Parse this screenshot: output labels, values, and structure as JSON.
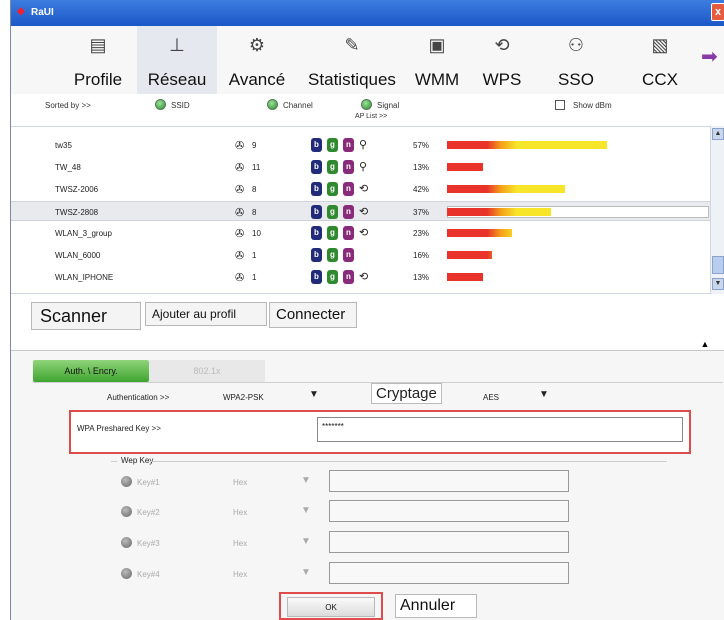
{
  "window": {
    "title": "RaUI",
    "close": "x"
  },
  "toolbar": [
    {
      "label": "Profile",
      "icon": "profile-icon",
      "glyph": "▤"
    },
    {
      "label": "Réseau",
      "icon": "network-icon",
      "glyph": "⊥"
    },
    {
      "label": "Avancé",
      "icon": "advanced-gear-icon",
      "glyph": "⚙"
    },
    {
      "label": "Statistiques",
      "icon": "statistics-icon",
      "glyph": "✎"
    },
    {
      "label": "WMM",
      "icon": "wmm-icon",
      "glyph": "▣"
    },
    {
      "label": "WPS",
      "icon": "wps-icon",
      "glyph": "⟲"
    },
    {
      "label": "SSO",
      "icon": "sso-icon",
      "glyph": "⚇"
    },
    {
      "label": "CCX",
      "icon": "ccx-icon",
      "glyph": "▧"
    }
  ],
  "toolbar_more": "➡",
  "sortbar": {
    "sorted_by": "Sorted by >>",
    "ssid": "SSID",
    "channel": "Channel",
    "signal": "Signal",
    "ap_list": "AP List >>",
    "show_dbm": "Show dBm"
  },
  "ap_list": [
    {
      "ssid": "tw35",
      "channel": "9",
      "modes": [
        "b",
        "g",
        "n"
      ],
      "security": "⚲",
      "signal": "57%",
      "signal_value": 57
    },
    {
      "ssid": "TW_48",
      "channel": "11",
      "modes": [
        "b",
        "g",
        "n"
      ],
      "security": "⚲",
      "signal": "13%",
      "signal_value": 13
    },
    {
      "ssid": "TWSZ-2006",
      "channel": "8",
      "modes": [
        "b",
        "g",
        "n"
      ],
      "security": "⟲",
      "signal": "42%",
      "signal_value": 42
    },
    {
      "ssid": "TWSZ-2808",
      "channel": "8",
      "modes": [
        "b",
        "g",
        "n"
      ],
      "security": "⟲",
      "signal": "37%",
      "signal_value": 37,
      "selected": true
    },
    {
      "ssid": "WLAN_3_group",
      "channel": "10",
      "modes": [
        "b",
        "g",
        "n"
      ],
      "security": "⟲",
      "signal": "23%",
      "signal_value": 23
    },
    {
      "ssid": "WLAN_6000",
      "channel": "1",
      "modes": [
        "b",
        "g",
        "n"
      ],
      "security": "",
      "signal": "16%",
      "signal_value": 16
    },
    {
      "ssid": "WLAN_IPHONE",
      "channel": "1",
      "modes": [
        "b",
        "g",
        "n"
      ],
      "security": "⟲",
      "signal": "13%",
      "signal_value": 13
    }
  ],
  "buttons": {
    "scan": "Scanner",
    "add_profile": "Ajouter au profil",
    "connect": "Connecter",
    "collapse": "▲"
  },
  "tabs": {
    "auth": "Auth. \\ Encry.",
    "8021x": "802.1x"
  },
  "auth": {
    "authentication_label": "Authentication >>",
    "authentication_value": "WPA2-PSK",
    "encryption_label": "Cryptage",
    "encryption_value": "AES",
    "psk_label": "WPA Preshared Key >>",
    "psk_value": "*******"
  },
  "wep": {
    "legend": "Wep Key",
    "keys": [
      {
        "label": "Key#1",
        "format": "Hex"
      },
      {
        "label": "Key#2",
        "format": "Hex"
      },
      {
        "label": "Key#3",
        "format": "Hex"
      },
      {
        "label": "Key#4",
        "format": "Hex"
      }
    ]
  },
  "footer": {
    "ok": "OK",
    "cancel": "Annuler"
  },
  "colors": {
    "title_blue": "#1c57c7",
    "tab_green": "#3fa42f",
    "highlight_red": "#e04b4b"
  }
}
